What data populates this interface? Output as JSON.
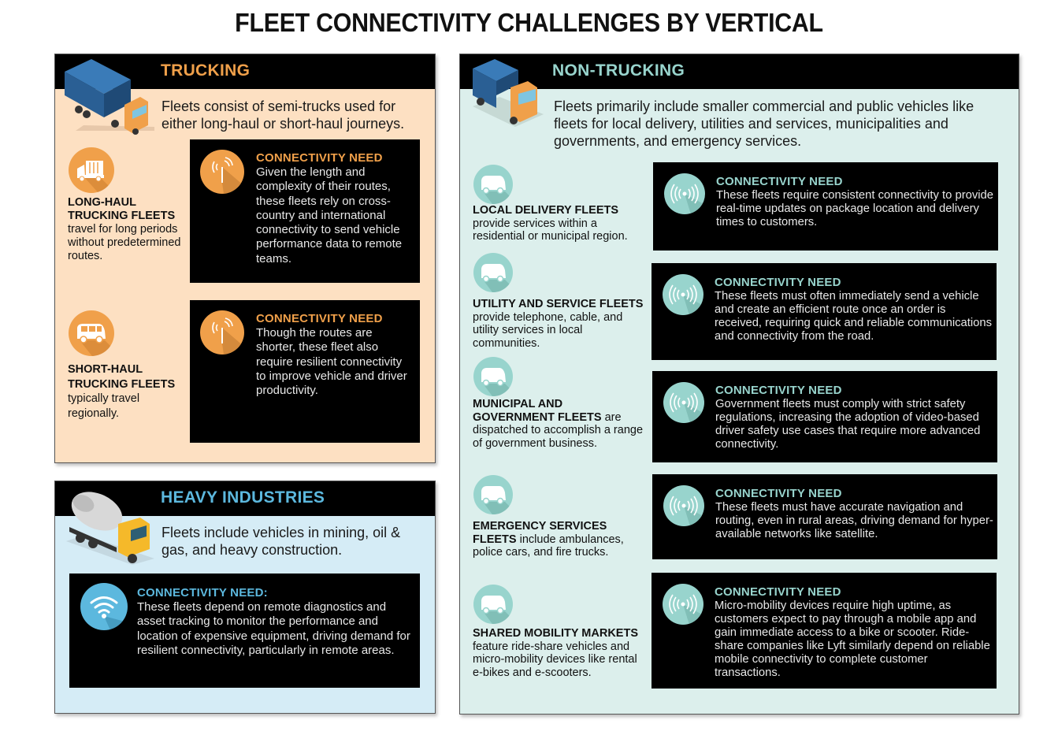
{
  "title": "FLEET CONNECTIVITY CHALLENGES BY VERTICAL",
  "colors": {
    "trucking_accent": "#f0a04a",
    "trucking_bg": "#fde0c2",
    "heavy_accent": "#5cb8de",
    "heavy_bg": "#d5ecf6",
    "nontrucking_accent": "#98d4cd",
    "nontrucking_bg": "#dcefec",
    "box_bg": "#000000"
  },
  "trucking": {
    "title": "TRUCKING",
    "hero_icon": "semi-truck-icon",
    "intro": "Fleets consist of semi-trucks used for either long-haul or short-haul journeys.",
    "items": [
      {
        "icon": "box-truck-icon",
        "label_bold": "LONG-HAUL TRUCKING FLEETS",
        "label_rest": "travel for long periods without predetermined routes.",
        "need_icon": "antenna-icon",
        "need_title": "CONNECTIVITY NEED",
        "need_text": "Given the length and complexity of their routes, these fleets rely on cross-country and international connectivity to send vehicle performance data to remote teams."
      },
      {
        "icon": "van-icon",
        "label_bold": "SHORT-HAUL TRUCKING FLEETS",
        "label_rest": "typically travel regionally.",
        "need_icon": "antenna-icon",
        "need_title": "CONNECTIVITY NEED",
        "need_text": "Though the routes are shorter, these fleet also require resilient connectivity to improve vehicle and driver productivity."
      }
    ]
  },
  "heavy": {
    "title": "HEAVY INDUSTRIES",
    "hero_icon": "cement-mixer-icon",
    "intro": "Fleets include vehicles in mining, oil & gas, and heavy construction.",
    "need_icon": "wifi-icon",
    "need_title": "CONNECTIVITY NEED:",
    "need_text": "These fleets depend on remote diagnostics and asset tracking to monitor the performance and location of expensive equipment, driving demand for resilient connectivity, particularly in remote areas."
  },
  "nontrucking": {
    "title": "NON-TRUCKING",
    "hero_icon": "delivery-truck-icon",
    "intro": "Fleets primarily include smaller commercial and public vehicles like fleets for local delivery, utilities and services, municipalities and governments, and emergency services.",
    "items": [
      {
        "icon": "delivery-van-icon",
        "label_bold": "LOCAL DELIVERY FLEETS",
        "label_rest": "provide services within a residential or municipal region.",
        "need_icon": "broadcast-signal-icon",
        "need_title": "CONNECTIVITY NEED",
        "need_text": "These fleets require consistent connectivity to provide real-time updates on package location and delivery times to customers."
      },
      {
        "icon": "utility-truck-icon",
        "label_bold": "UTILITY AND SERVICE FLEETS",
        "label_rest": "provide telephone, cable, and utility services in local communities.",
        "need_icon": "broadcast-signal-icon",
        "need_title": "CONNECTIVITY NEED",
        "need_text": "These fleets must often immediately send a vehicle and create an efficient route once an order is received, requiring quick and reliable communications and connectivity from the road."
      },
      {
        "icon": "municipal-truck-icon",
        "label_bold": "MUNICIPAL AND GOVERNMENT FLEETS",
        "label_rest": "are dispatched to accomplish a range of government business.",
        "need_icon": "broadcast-signal-icon",
        "need_title": "CONNECTIVITY NEED",
        "need_text": "Government fleets must comply with strict safety regulations, increasing the adoption of video-based driver safety use cases that require more advanced connectivity."
      },
      {
        "icon": "tow-truck-icon",
        "label_bold": "EMERGENCY SERVICES FLEETS",
        "label_rest": "include ambulances, police cars, and fire trucks.",
        "need_icon": "broadcast-signal-icon",
        "need_title": "CONNECTIVITY NEED",
        "need_text": "These fleets must have accurate navigation and routing, even in rural areas, driving demand for hyper-available networks like satellite."
      },
      {
        "icon": "jeep-icon",
        "label_bold": "SHARED MOBILITY MARKETS",
        "label_rest": "feature ride-share vehicles and micro-mobility devices like rental e-bikes and e-scooters.",
        "need_icon": "broadcast-signal-icon",
        "need_title": "CONNECTIVITY NEED",
        "need_text": "Micro-mobility devices require high uptime, as customers expect to pay through a mobile app and gain immediate access to a bike or scooter. Ride-share companies like Lyft similarly depend on reliable mobile connectivity to complete customer transactions."
      }
    ]
  }
}
